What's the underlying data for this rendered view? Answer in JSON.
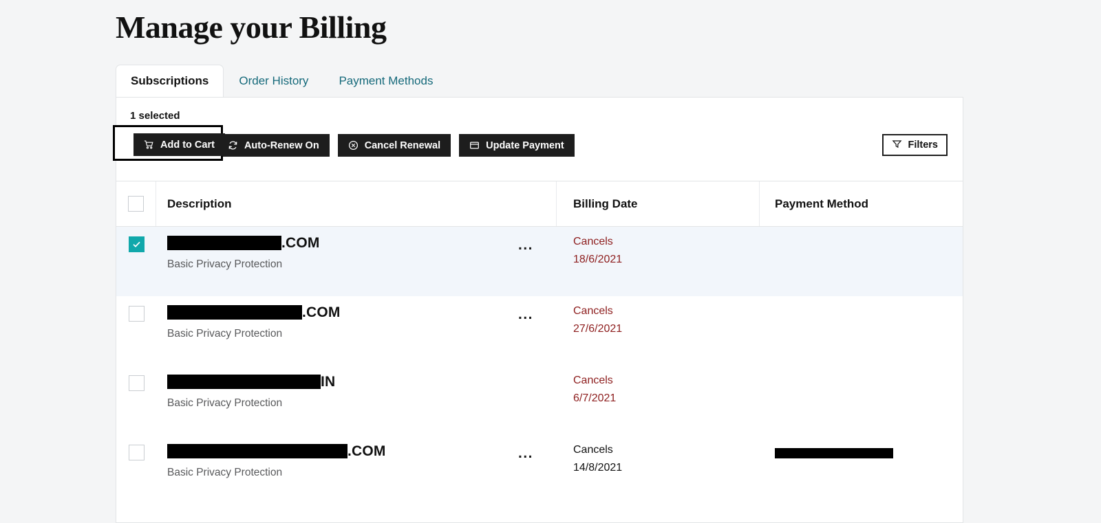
{
  "page": {
    "title": "Manage your Billing",
    "background_color": "#f4f5f6"
  },
  "tabs": [
    {
      "label": "Subscriptions",
      "active": true
    },
    {
      "label": "Order History",
      "active": false
    },
    {
      "label": "Payment Methods",
      "active": false
    }
  ],
  "toolbar": {
    "selected_count_label": "1 selected",
    "actions": [
      {
        "label": "Add to Cart",
        "icon": "shopping-cart-icon",
        "focused": true
      },
      {
        "label": "Auto-Renew On",
        "icon": "refresh-icon",
        "focused": false
      },
      {
        "label": "Cancel Renewal",
        "icon": "circle-x-icon",
        "focused": false
      },
      {
        "label": "Update Payment",
        "icon": "credit-card-icon",
        "focused": false
      }
    ],
    "filters_label": "Filters",
    "filters_icon": "funnel-icon",
    "button_color": "#1d1d1d"
  },
  "table": {
    "headers": {
      "description": "Description",
      "billing_date": "Billing Date",
      "payment_method": "Payment Method"
    },
    "select_all_checked": false,
    "accent_checkbox_color": "#11a8ab",
    "selected_row_color": "#f2f6fb",
    "cancel_text_color": "#8d1d1d",
    "rows": [
      {
        "checked": true,
        "redacted": true,
        "redaction_width": 166,
        "domain_visible": ".COM",
        "plan": "Basic Privacy Protection",
        "has_overflow_menu": true,
        "overflow_label": "...",
        "billing_status": "Cancels",
        "billing_date": "18/6/2021",
        "billing_highlight": true,
        "payment_method_redacted": false
      },
      {
        "checked": false,
        "redacted": true,
        "redaction_width": 196,
        "domain_visible": ".COM",
        "plan": "Basic Privacy Protection",
        "has_overflow_menu": true,
        "overflow_label": "...",
        "billing_status": "Cancels",
        "billing_date": "27/6/2021",
        "billing_highlight": true,
        "payment_method_redacted": false
      },
      {
        "checked": false,
        "redacted": true,
        "redaction_width": 223,
        "domain_visible": "IN",
        "plan": "Basic Privacy Protection",
        "has_overflow_menu": false,
        "overflow_label": "...",
        "billing_status": "Cancels",
        "billing_date": "6/7/2021",
        "billing_highlight": true,
        "payment_method_redacted": false
      },
      {
        "checked": false,
        "redacted": true,
        "redaction_width": 262,
        "domain_visible": ".COM",
        "plan": "Basic Privacy Protection",
        "has_overflow_menu": true,
        "overflow_label": "...",
        "billing_status": "Cancels",
        "billing_date": "14/8/2021",
        "billing_highlight": false,
        "payment_method_redacted": true,
        "payment_redaction_width": 172
      }
    ]
  }
}
